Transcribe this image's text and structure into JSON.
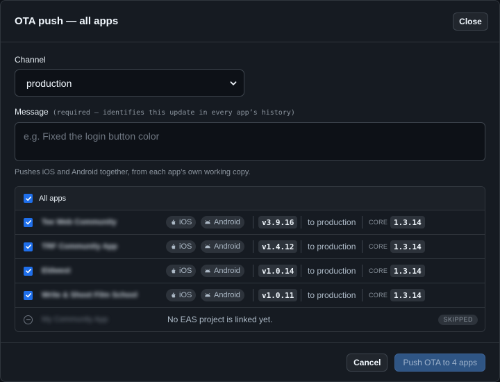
{
  "modal": {
    "title": "OTA push — all apps",
    "close_label": "Close"
  },
  "channel": {
    "label": "Channel",
    "selected": "production"
  },
  "message": {
    "label": "Message",
    "hint": "(required — identifies this update in every app’s history)",
    "placeholder": "e.g. Fixed the login button color",
    "value": ""
  },
  "note": "Pushes iOS and Android together, from each app’s own working copy.",
  "apps": {
    "all_label": "All apps",
    "rows": [
      {
        "name": "Tee Web Community",
        "checked": true,
        "ios": "iOS",
        "android": "Android",
        "version": "v3.9.16",
        "target": "to production",
        "core_label": "CORE",
        "core_version": "1.3.14"
      },
      {
        "name": "TRF Community App",
        "checked": true,
        "ios": "iOS",
        "android": "Android",
        "version": "v1.4.12",
        "target": "to production",
        "core_label": "CORE",
        "core_version": "1.3.14"
      },
      {
        "name": "Eldwest",
        "checked": true,
        "ios": "iOS",
        "android": "Android",
        "version": "v1.0.14",
        "target": "to production",
        "core_label": "CORE",
        "core_version": "1.3.14"
      },
      {
        "name": "Write & Shoot Film School",
        "checked": true,
        "ios": "iOS",
        "android": "Android",
        "version": "v1.0.11",
        "target": "to production",
        "core_label": "CORE",
        "core_version": "1.3.14"
      }
    ],
    "skipped_row": {
      "name": "My Community App",
      "message": "No EAS project is linked yet.",
      "badge": "SKIPPED"
    }
  },
  "footer": {
    "cancel_label": "Cancel",
    "push_label": "Push OTA to 4 apps"
  },
  "colors": {
    "accent": "#1f6feb",
    "primary_button": "#2f5584",
    "background": "#161b22"
  }
}
